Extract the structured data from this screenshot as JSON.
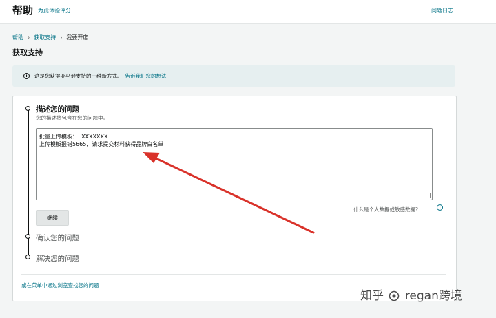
{
  "header": {
    "title": "帮助",
    "subtitle_link": "为此体验评分",
    "right_link": "问题日志"
  },
  "breadcrumb": [
    "帮助",
    "获取支持",
    "我要开店"
  ],
  "page_title": "获取支持",
  "notice": {
    "text": "这是您获得亚马逊支持的一种新方式。",
    "link": "告诉我们您的想法"
  },
  "steps": {
    "step1": {
      "title": "描述您的问题",
      "desc": "您的描述将包含在您的问题中。",
      "textarea_lines": [
        "批量上传模板：  XXXXXXX",
        "上传模板报错5665，请求提交材料获得品牌白名单"
      ],
      "privacy_text": "什么是个人数据或敏感数据?",
      "continue_label": "继续"
    },
    "step2": {
      "title": "确认您的问题"
    },
    "step3": {
      "title": "解决您的问题"
    }
  },
  "browse_link": "或在菜单中通过浏览查找您的问题",
  "watermark": {
    "left": "知乎",
    "right": "regan跨境"
  },
  "colors": {
    "link": "#007185",
    "annotation_arrow": "#d9322a",
    "notice_bg": "#e6eff0"
  },
  "icons": [
    "info-icon",
    "info-icon",
    "pointer-arrow"
  ]
}
